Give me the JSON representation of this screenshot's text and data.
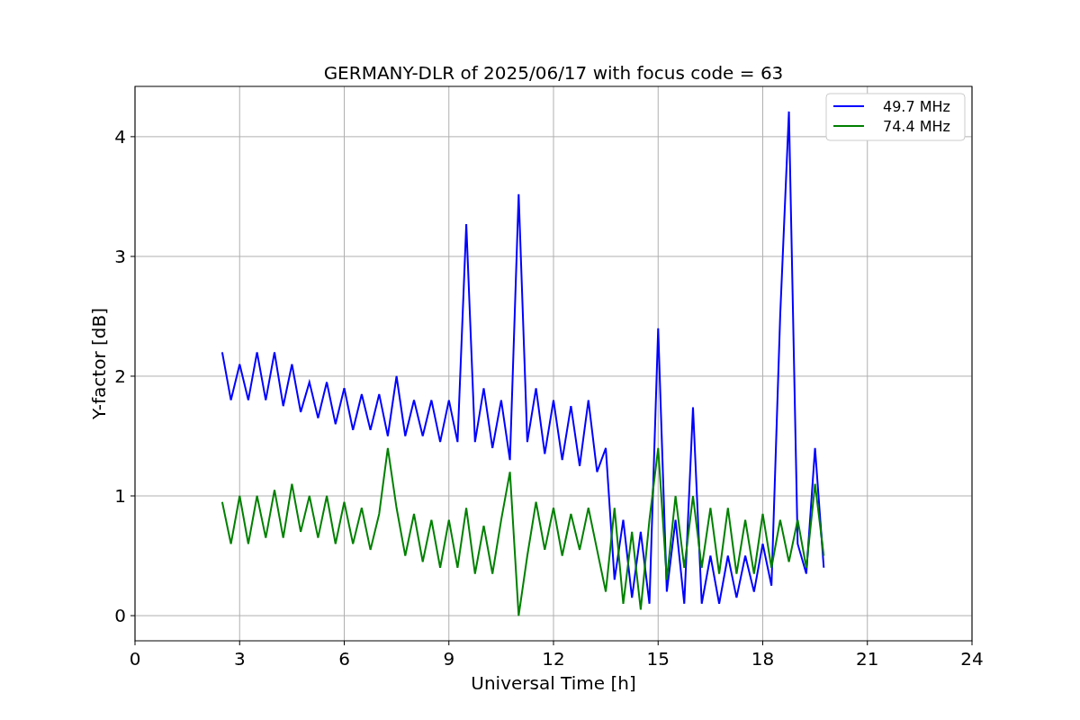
{
  "chart_data": {
    "type": "line",
    "title": "GERMANY-DLR of 2025/06/17 with focus code = 63",
    "xlabel": "Universal Time [h]",
    "ylabel": "Y-factor [dB]",
    "x": [
      2.5,
      2.75,
      3,
      3.25,
      3.5,
      3.75,
      4,
      4.25,
      4.5,
      4.75,
      5,
      5.25,
      5.5,
      5.75,
      6,
      6.25,
      6.5,
      6.75,
      7,
      7.25,
      7.5,
      7.75,
      8,
      8.25,
      8.5,
      8.75,
      9,
      9.25,
      9.5,
      9.75,
      10,
      10.25,
      10.5,
      10.75,
      11,
      11.25,
      11.5,
      11.75,
      12,
      12.25,
      12.5,
      12.75,
      13,
      13.25,
      13.5,
      13.75,
      14,
      14.25,
      14.5,
      14.75,
      15,
      15.25,
      15.5,
      15.75,
      16,
      16.25,
      16.5,
      16.75,
      17,
      17.25,
      17.5,
      17.75,
      18,
      18.25,
      18.5,
      18.75,
      19,
      19.25,
      19.5,
      19.75
    ],
    "series": [
      {
        "name": "49.7 MHz",
        "color": "#0000ff",
        "values": [
          2.2,
          1.8,
          2.1,
          1.8,
          2.2,
          1.8,
          2.2,
          1.75,
          2.1,
          1.7,
          1.95,
          1.65,
          1.95,
          1.6,
          1.9,
          1.55,
          1.85,
          1.55,
          1.85,
          1.5,
          2.0,
          1.5,
          1.8,
          1.5,
          1.8,
          1.45,
          1.8,
          1.45,
          3.27,
          1.45,
          1.9,
          1.4,
          1.8,
          1.3,
          3.52,
          1.45,
          1.9,
          1.35,
          1.8,
          1.3,
          1.75,
          1.25,
          1.8,
          1.2,
          1.4,
          0.3,
          0.8,
          0.15,
          0.7,
          0.1,
          2.4,
          0.2,
          0.8,
          0.1,
          1.74,
          0.1,
          0.5,
          0.1,
          0.5,
          0.15,
          0.5,
          0.2,
          0.6,
          0.25,
          2.51,
          4.21,
          0.6,
          0.35,
          1.4,
          0.4
        ]
      },
      {
        "name": "74.4 MHz",
        "color": "#008000",
        "values": [
          0.95,
          0.6,
          1.0,
          0.6,
          1.0,
          0.65,
          1.05,
          0.65,
          1.1,
          0.7,
          1.0,
          0.65,
          1.0,
          0.6,
          0.95,
          0.6,
          0.9,
          0.55,
          0.85,
          1.4,
          0.9,
          0.5,
          0.85,
          0.45,
          0.8,
          0.4,
          0.8,
          0.4,
          0.9,
          0.35,
          0.75,
          0.35,
          0.8,
          1.2,
          0.0,
          0.5,
          0.95,
          0.55,
          0.9,
          0.5,
          0.85,
          0.55,
          0.9,
          0.55,
          0.2,
          0.9,
          0.1,
          0.7,
          0.05,
          0.8,
          1.4,
          0.3,
          1.0,
          0.4,
          1.0,
          0.4,
          0.9,
          0.35,
          0.9,
          0.35,
          0.8,
          0.35,
          0.85,
          0.4,
          0.8,
          0.45,
          0.8,
          0.4,
          1.1,
          0.5
        ]
      }
    ],
    "grid": true,
    "legend": "upper right",
    "xlim": [
      0,
      24
    ],
    "ylim": [
      -0.21,
      4.42
    ],
    "xticks": [
      0,
      3,
      6,
      9,
      12,
      15,
      18,
      21,
      24
    ],
    "yticks": [
      0,
      1,
      2,
      3,
      4
    ]
  }
}
